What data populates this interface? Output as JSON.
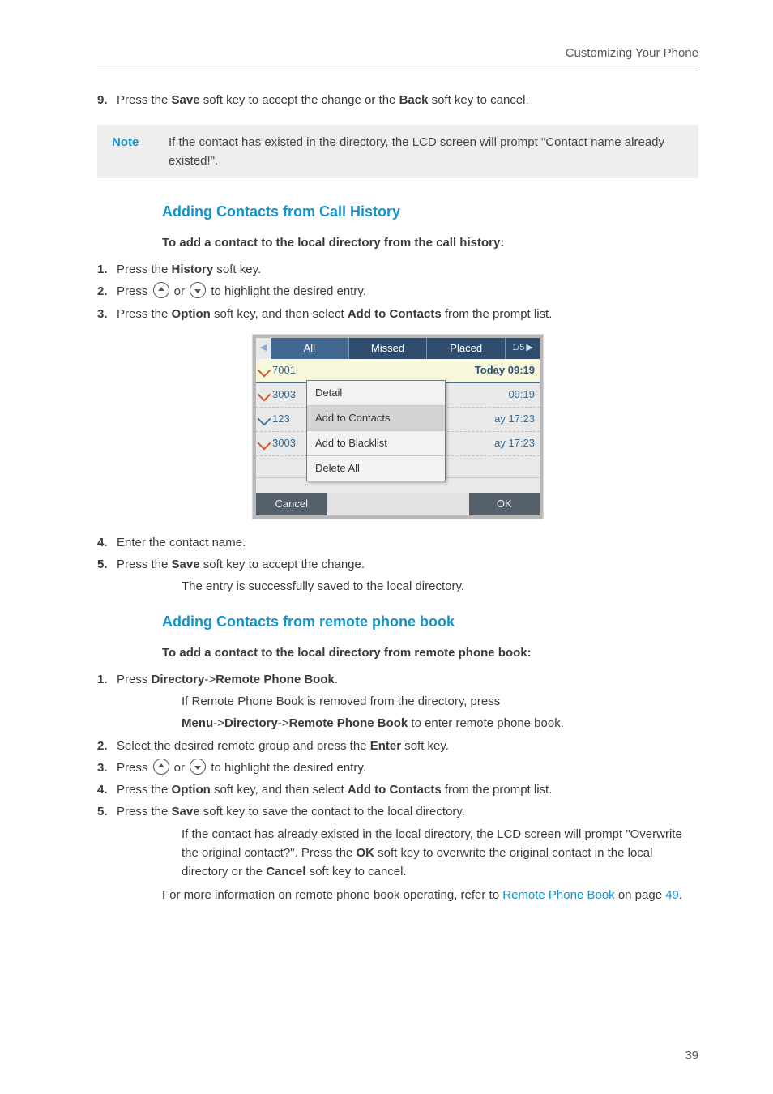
{
  "header": {
    "title": "Customizing Your Phone"
  },
  "step9": {
    "num": "9.",
    "t1": "Press the ",
    "save": "Save",
    "t2": " soft key to accept the change or the ",
    "back": "Back",
    "t3": " soft key to cancel."
  },
  "note": {
    "label": "Note",
    "text": "If the contact has existed in the directory, the LCD screen will prompt \"Contact name already existed!\"."
  },
  "secA": {
    "title": "Adding Contacts from Call History",
    "lead": "To add a contact to the local directory from the call history:",
    "s1": {
      "num": "1.",
      "t1": "Press the ",
      "b": "History",
      "t2": " soft key."
    },
    "s2": {
      "num": "2.",
      "t1": "Press ",
      "t2": " or ",
      "t3": " to highlight the desired entry."
    },
    "s3": {
      "num": "3.",
      "t1": "Press the ",
      "b1": "Option",
      "t2": " soft key, and then select ",
      "b2": "Add to Contacts",
      "t3": " from the prompt list."
    },
    "s4": {
      "num": "4.",
      "t": "Enter the contact name."
    },
    "s5": {
      "num": "5.",
      "t1": "Press the ",
      "b": "Save",
      "t2": " soft key to accept the change."
    },
    "s5a": "The entry is successfully saved to the local directory."
  },
  "phone": {
    "tabs": {
      "all": "All",
      "missed": "Missed",
      "placed": "Placed",
      "count": "1/5"
    },
    "rows": [
      {
        "num": "7001",
        "time": "Today 09:19"
      },
      {
        "num": "3003",
        "time": "09:19"
      },
      {
        "num": "123",
        "time": "ay 17:23"
      },
      {
        "num": "3003",
        "time": "ay 17:23"
      }
    ],
    "menu": [
      "Detail",
      "Add to Contacts",
      "Add to Blacklist",
      "Delete All"
    ],
    "soft": {
      "left": "Cancel",
      "right": "OK"
    },
    "arrow": "▶"
  },
  "secB": {
    "title": "Adding Contacts from remote phone book",
    "lead": "To add a contact to the local directory from remote phone book:",
    "s1": {
      "num": "1.",
      "t1": "Press ",
      "b1": "Directory",
      "arrow": "->",
      "b2": "Remote Phone Book",
      "dot": "."
    },
    "s1a": "If Remote Phone Book is removed from the directory, press",
    "s1b": {
      "b1": "Menu",
      "a1": "->",
      "b2": "Directory",
      "a2": "->",
      "b3": "Remote Phone Book",
      "t": " to enter remote phone book."
    },
    "s2": {
      "num": "2.",
      "t1": "Select the desired remote group and press the ",
      "b": "Enter",
      "t2": " soft key."
    },
    "s3": {
      "num": "3.",
      "t1": "Press ",
      "t2": " or ",
      "t3": " to highlight the desired entry."
    },
    "s4": {
      "num": "4.",
      "t1": "Press the ",
      "b1": "Option",
      "t2": " soft key, and then select ",
      "b2": "Add to Contacts",
      "t3": " from the prompt list."
    },
    "s5": {
      "num": "5.",
      "t1": "Press the ",
      "b": "Save",
      "t2": " soft key to save the contact to the local directory."
    },
    "s5a": {
      "t1": "If the contact has already existed in the local directory, the LCD screen will prompt \"Overwrite the original contact?\". Press the ",
      "b1": "OK",
      "t2": " soft key to overwrite the original contact in the local directory or the ",
      "b2": "Cancel",
      "t3": " soft key to cancel."
    },
    "tail": {
      "t1": "For more information on remote phone book operating, refer to ",
      "link": "Remote Phone Book",
      "t2": " on page ",
      "pg": "49",
      "dot": "."
    }
  },
  "pgnum": "39"
}
